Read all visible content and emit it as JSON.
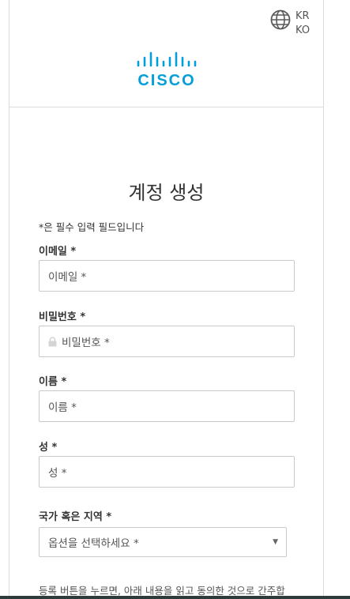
{
  "header": {
    "language": {
      "region": "KR",
      "code": "KO",
      "icon": "globe-icon"
    },
    "logo": {
      "text": "CISCO",
      "icon": "cisco-logo-icon",
      "color": "#049fd9"
    }
  },
  "form": {
    "title": "계정 생성",
    "required_note": "*은 필수 입력 필드입니다",
    "fields": [
      {
        "label": "이메일 *",
        "placeholder": "이메일 *",
        "value": ""
      },
      {
        "label": "비밀번호 *",
        "placeholder": "비밀번호 *",
        "value": "",
        "icon": "lock-icon"
      },
      {
        "label": "이름 *",
        "placeholder": "이름 *",
        "value": ""
      },
      {
        "label": "성 *",
        "placeholder": "성 *",
        "value": ""
      }
    ],
    "country": {
      "label": "국가 혹은 지역 *",
      "selected": "옵션을 선택하세요 *"
    },
    "terms_text": "등록 버튼을 누르면, 아래 내용을 읽고 동의한 것으로 간주합"
  }
}
